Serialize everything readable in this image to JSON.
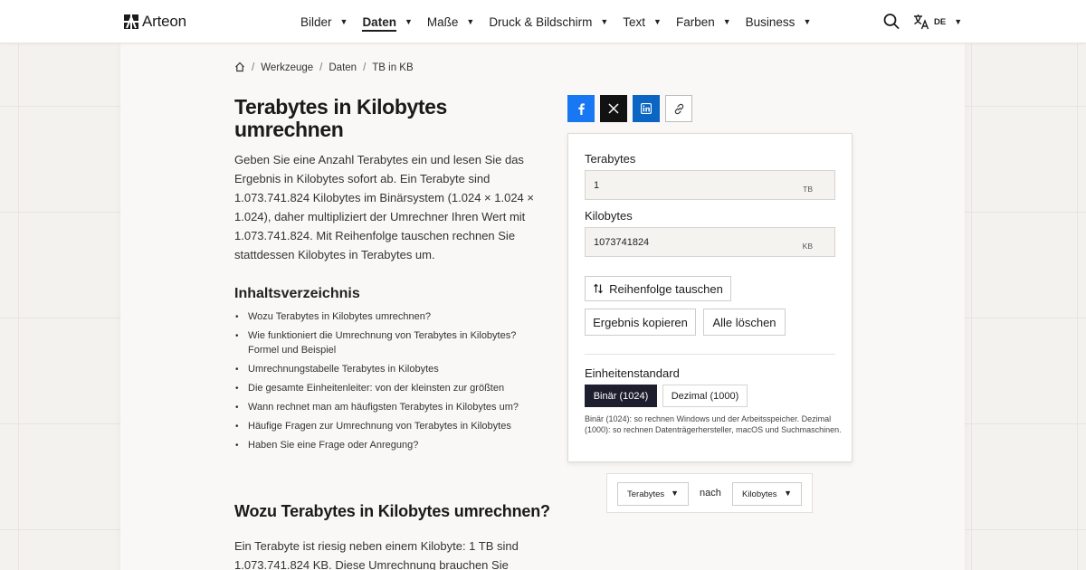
{
  "header": {
    "brand": "Arteon",
    "nav": [
      {
        "label": "Bilder",
        "active": false
      },
      {
        "label": "Daten",
        "active": true
      },
      {
        "label": "Maße",
        "active": false
      },
      {
        "label": "Druck & Bildschirm",
        "active": false
      },
      {
        "label": "Text",
        "active": false
      },
      {
        "label": "Farben",
        "active": false
      },
      {
        "label": "Business",
        "active": false
      }
    ],
    "search_icon": "search-icon",
    "language": "DE"
  },
  "breadcrumb": [
    "Werkzeuge",
    "Daten",
    "TB in KB"
  ],
  "title": "Terabytes in Kilobytes umrechnen",
  "intro": "Geben Sie eine Anzahl Terabytes ein und lesen Sie das Ergebnis in Kilobytes sofort ab. Ein Terabyte sind 1.073.741.824 Kilobytes im Binärsystem (1.024 × 1.024 × 1.024), daher multipliziert der Umrechner Ihren Wert mit 1.073.741.824. Mit Reihenfolge tauschen rechnen Sie stattdessen Kilobytes in Terabytes um.",
  "toc": {
    "heading": "Inhaltsverzeichnis",
    "items": [
      "Wozu Terabytes in Kilobytes umrechnen?",
      "Wie funktioniert die Umrechnung von Terabytes in Kilobytes? Formel und Beispiel",
      "Umrechnungstabelle Terabytes in Kilobytes",
      "Die gesamte Einheitenleiter: von der kleinsten zur größten",
      "Wann rechnet man am häufigsten Terabytes in Kilobytes um?",
      "Häufige Fragen zur Umrechnung von Terabytes in Kilobytes",
      "Haben Sie eine Frage oder Anregung?"
    ]
  },
  "section": {
    "heading": "Wozu Terabytes in Kilobytes umrechnen?",
    "text": "Ein Terabyte ist riesig neben einem Kilobyte: 1 TB sind 1.073.741.824 KB. Diese Umrechnung brauchen Sie selten,"
  },
  "share": [
    "facebook-icon",
    "x-icon",
    "linkedin-icon",
    "link-icon"
  ],
  "converter": {
    "from_label": "Terabytes",
    "from_value": "1",
    "from_unit": "TB",
    "to_label": "Kilobytes",
    "to_value": "1073741824",
    "to_unit": "KB",
    "swap_label": "Reihenfolge tauschen",
    "copy_label": "Ergebnis kopieren",
    "clear_label": "Alle löschen",
    "standard_heading": "Einheitenstandard",
    "standard_binary": "Binär (1024)",
    "standard_decimal": "Dezimal (1000)",
    "standard_selected": "binary",
    "standard_note": "Binär (1024): so rechnen Windows und der Arbeitsspeicher. Dezimal (1000): so rechnen Datenträgerhersteller, macOS und Suchmaschinen."
  },
  "unit_select": {
    "from": "Terabytes",
    "connector": "nach",
    "to": "Kilobytes"
  },
  "colors": {
    "background": "#f4f2ef",
    "card": "#faf8f6",
    "facebook": "#1877f2",
    "x": "#121212",
    "linkedin": "#0a66c2",
    "segment_active": "#1d1f2e"
  }
}
